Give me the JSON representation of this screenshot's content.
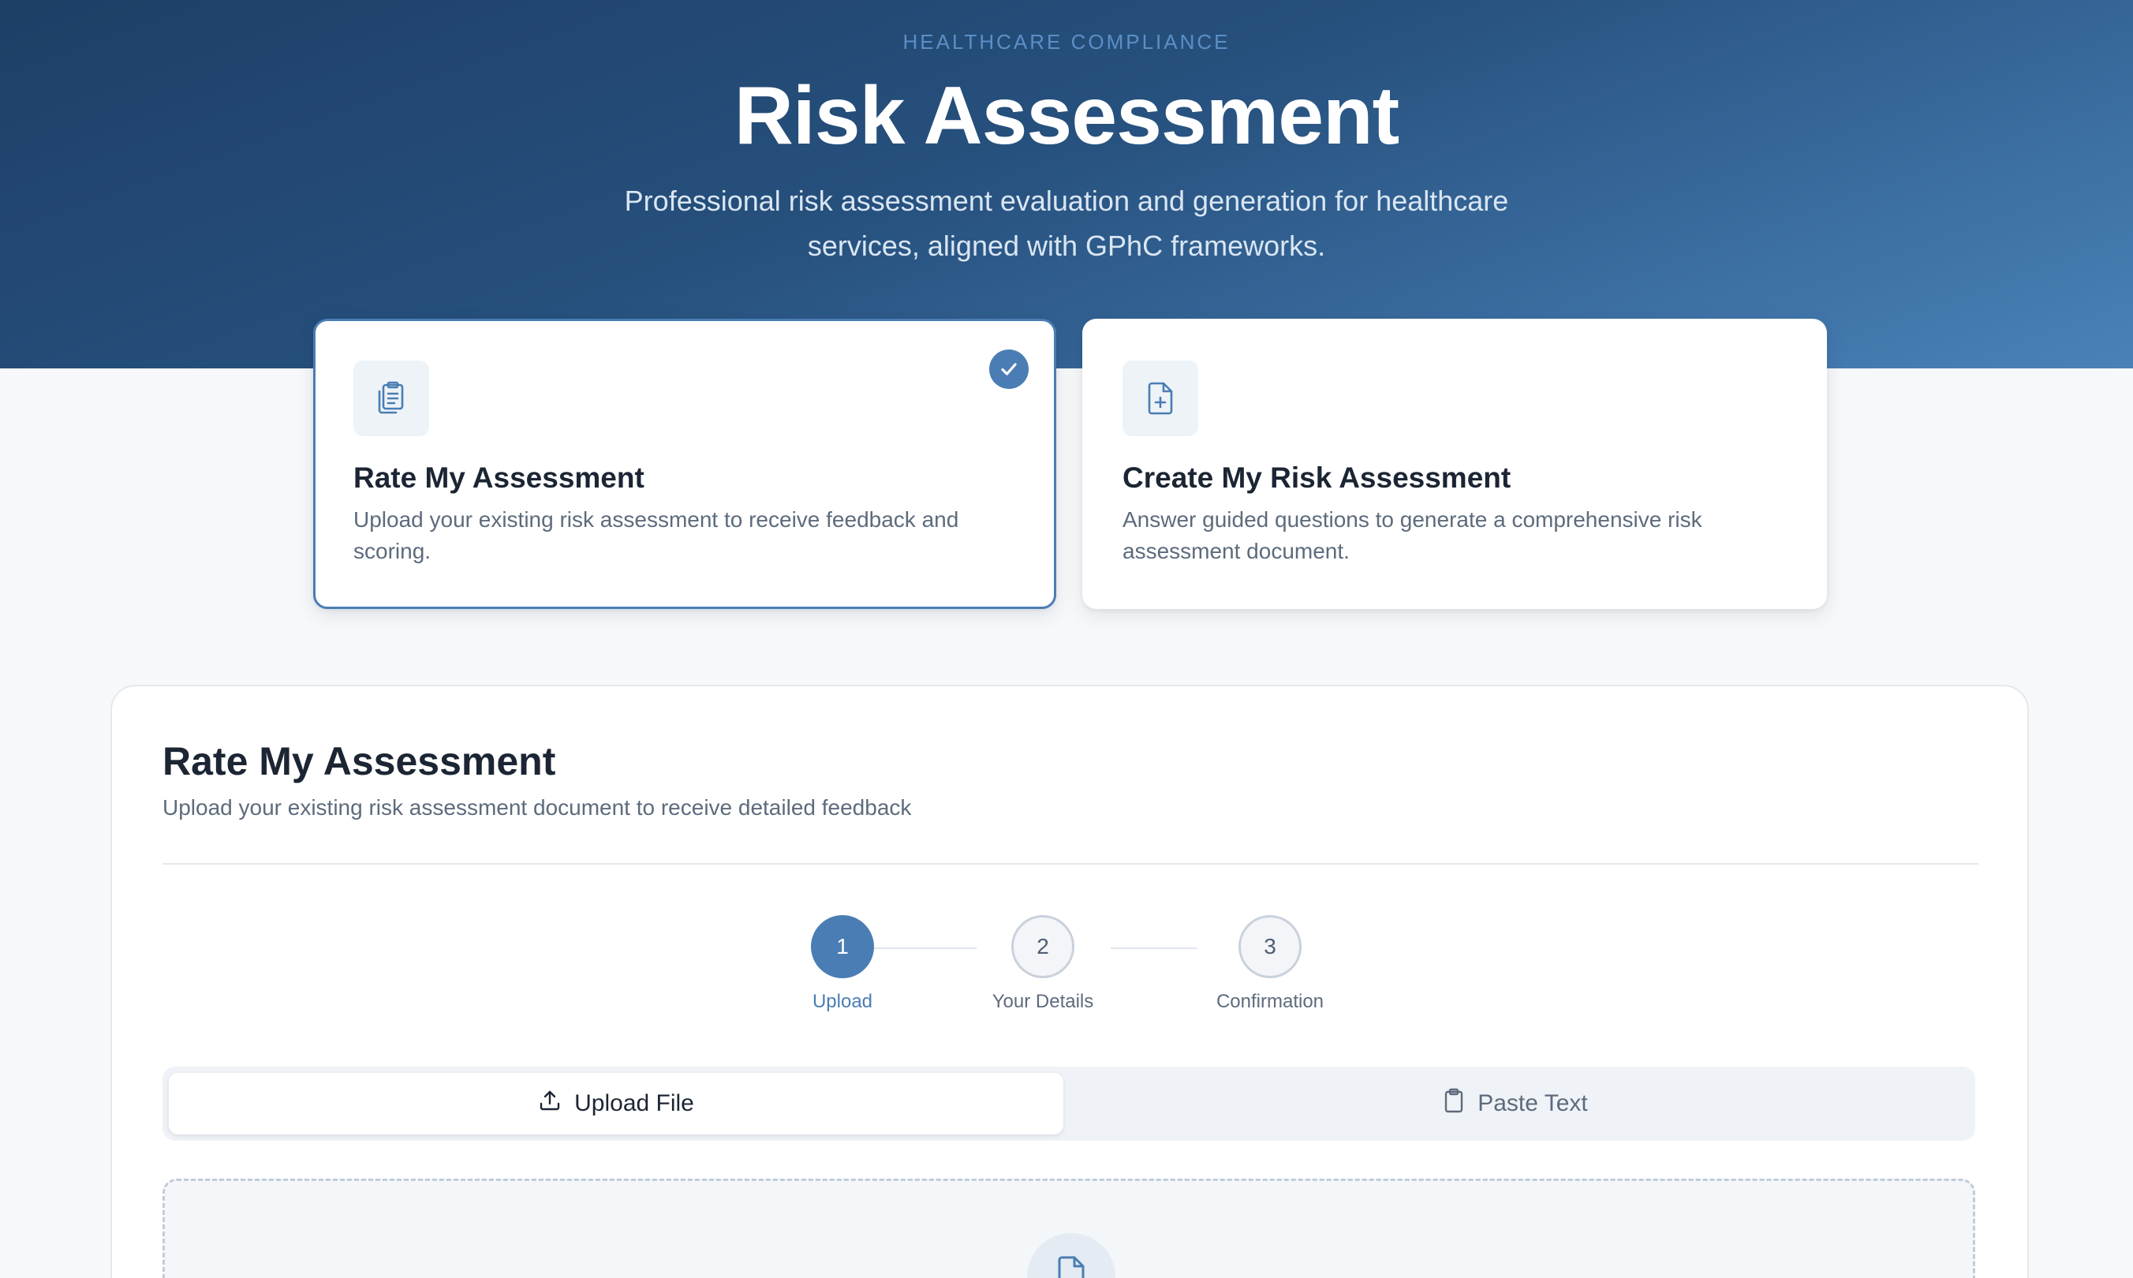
{
  "hero": {
    "eyebrow": "HEALTHCARE COMPLIANCE",
    "title": "Risk Assessment",
    "subtitle": "Professional risk assessment evaluation and generation for healthcare services, aligned with GPhC frameworks."
  },
  "mode_cards": [
    {
      "title": "Rate My Assessment",
      "description": "Upload your existing risk assessment to receive feedback and scoring.",
      "icon": "clipboard-list-icon",
      "selected": true
    },
    {
      "title": "Create My Risk Assessment",
      "description": "Answer guided questions to generate a comprehensive risk assessment document.",
      "icon": "file-plus-icon",
      "selected": false
    }
  ],
  "panel": {
    "title": "Rate My Assessment",
    "subtitle": "Upload your existing risk assessment document to receive detailed feedback"
  },
  "stepper": {
    "current_step": 1,
    "steps": [
      {
        "number": "1",
        "label": "Upload"
      },
      {
        "number": "2",
        "label": "Your Details"
      },
      {
        "number": "3",
        "label": "Confirmation"
      }
    ]
  },
  "tabs": [
    {
      "label": "Upload File",
      "icon": "upload-icon",
      "active": true
    },
    {
      "label": "Paste Text",
      "icon": "clipboard-icon",
      "active": false
    }
  ],
  "dropzone": {
    "icon": "file-upload-icon"
  },
  "colors": {
    "accent": "#4a7db3",
    "hero_dark": "#1e3f66",
    "hero_light": "#4a82b8",
    "text_primary": "#1c2533",
    "text_secondary": "#5d6b7c"
  }
}
